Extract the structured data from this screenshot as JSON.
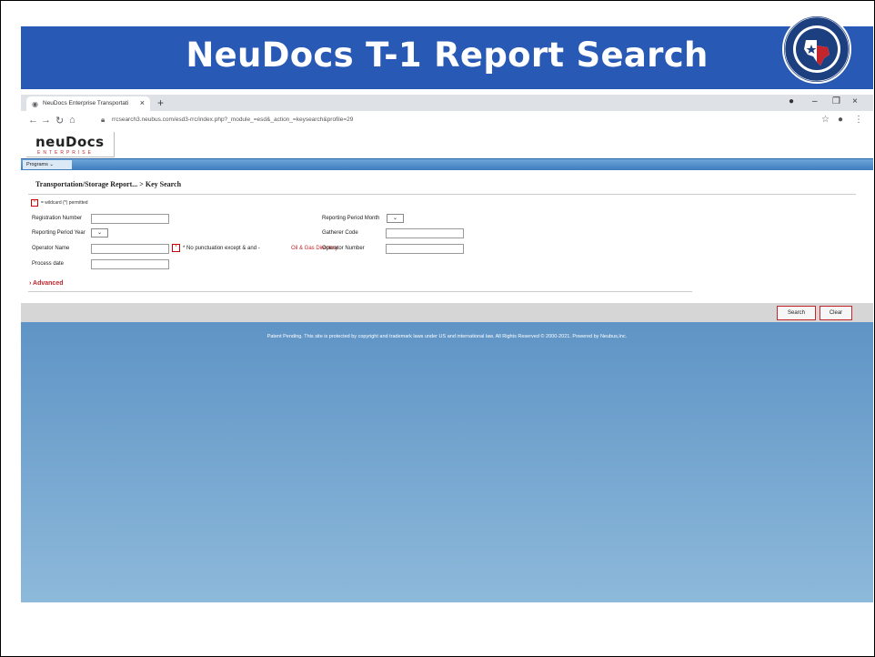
{
  "slide": {
    "title": "NeuDocs T-1 Report Search",
    "seal_icon": "railroad-commission-seal"
  },
  "browser": {
    "tab_title": "NeuDocs Enterprise Transportati",
    "tab_close": "×",
    "new_tab": "+",
    "url": "rrcsearch3.neubus.com/esd3-rrc/index.php?_module_=esd&_action_=keysearch&profile=29",
    "window_controls": [
      "–",
      "❐",
      "×"
    ]
  },
  "app": {
    "logo_main": "neuDocs",
    "logo_sub": "ENTERPRISE",
    "programs_menu": "Programs  ⌄",
    "breadcrumb": "Transportation/Storage Report... > Key Search",
    "wildcard_note": "= wildcard (*) permitted",
    "wildcard_marker": "*",
    "fields": {
      "registration_number": "Registration Number",
      "reporting_period_year": "Reporting Period Year",
      "operator_name": "Operator Name",
      "process_date": "Process date",
      "reporting_period_month": "Reporting Period Month",
      "gatherer_code": "Gatherer Code",
      "operator_number": "Operator Number"
    },
    "punctuation_note": "* No punctuation except & and -",
    "directory_link": "Oil & Gas Directory",
    "advanced": "Advanced",
    "advanced_icon": "›",
    "select_arrow": "⌄",
    "search_button": "Search",
    "clear_button": "Clear",
    "footer": "Patent Pending. This site is protected by copyright and trademark laws under US and international law. All Rights Reserved © 2000-2021. Powered by Neubus,Inc."
  }
}
